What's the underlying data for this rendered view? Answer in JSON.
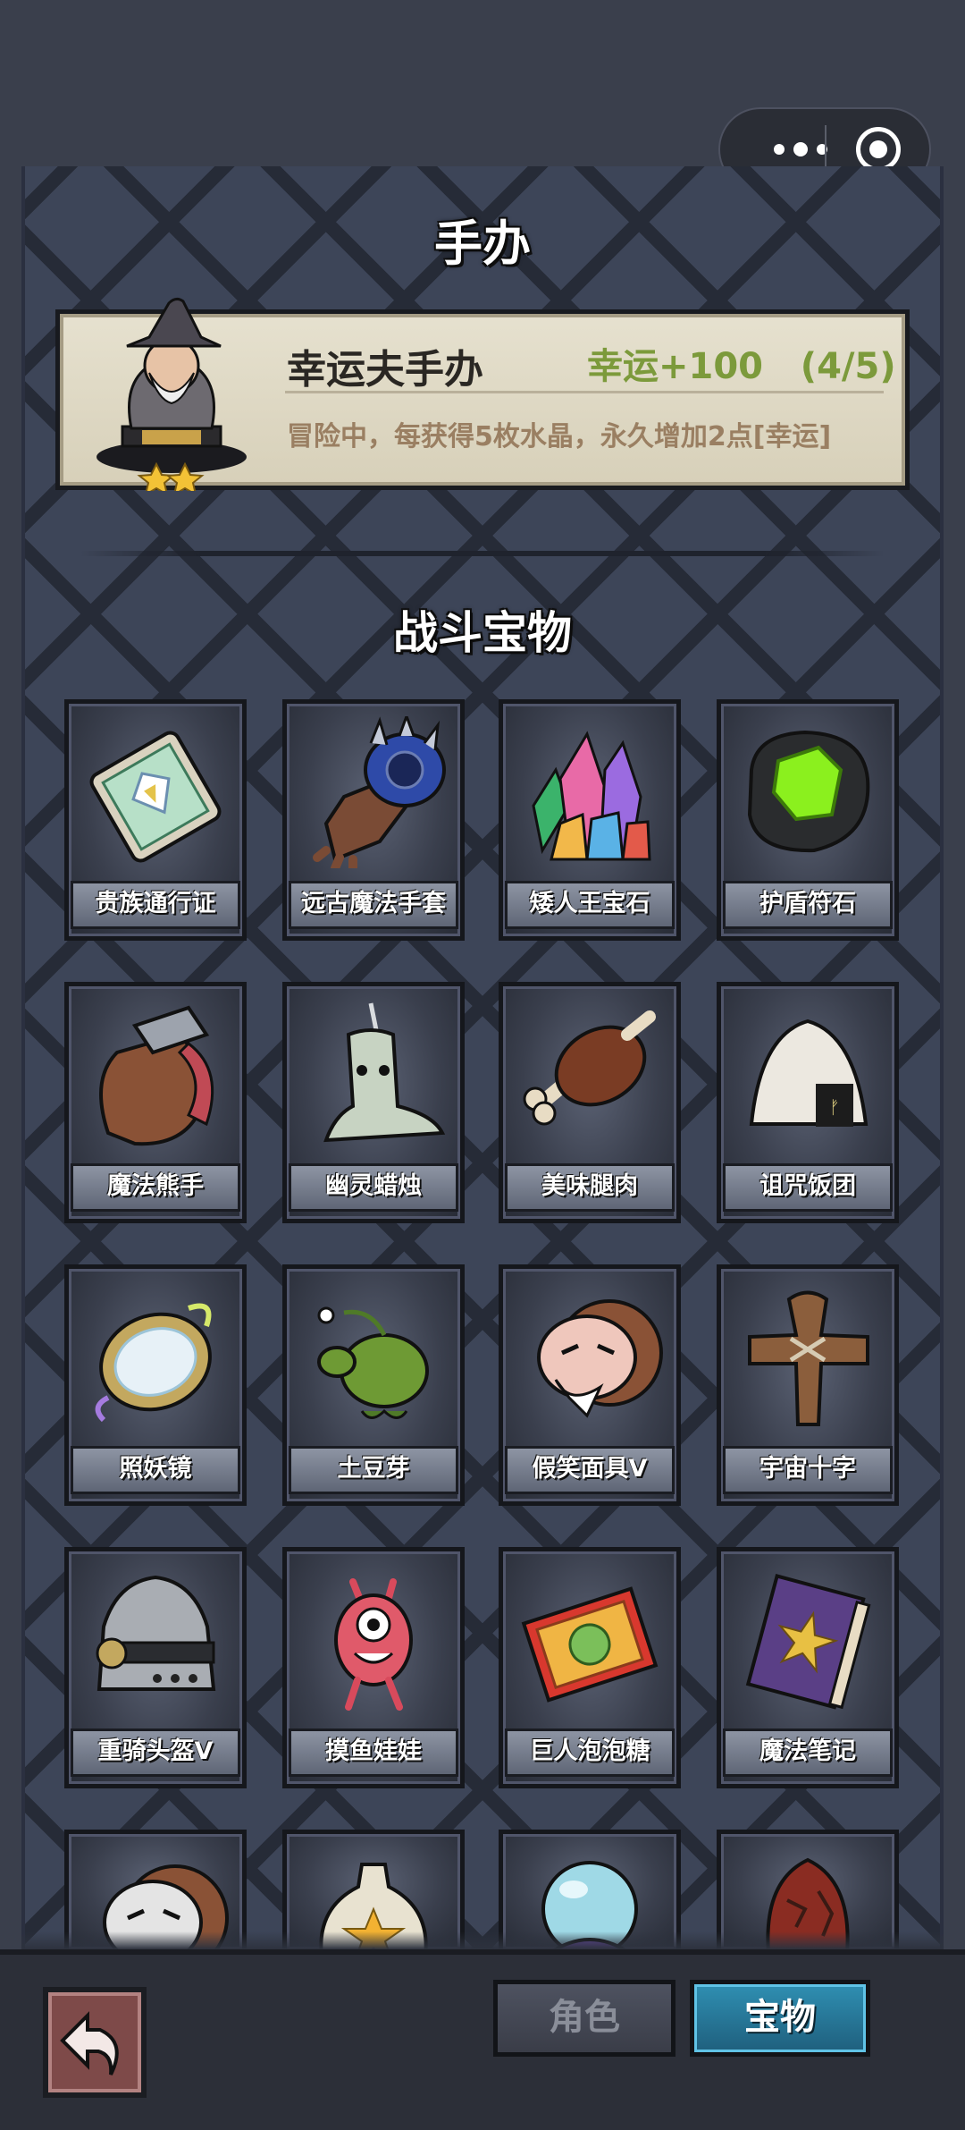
{
  "page_title": "手办",
  "figure": {
    "name": "幸运夫手办",
    "stat": "幸运+100",
    "progress": "(4/5)",
    "description": "冒险中，每获得5枚水晶，永久增加2点[幸运]",
    "stars": 2
  },
  "section_title": "战斗宝物",
  "treasures": [
    {
      "name": "贵族通行证",
      "icon": "pass-card-icon"
    },
    {
      "name": "远古魔法手套",
      "icon": "magic-glove-icon"
    },
    {
      "name": "矮人王宝石",
      "icon": "crystal-gem-icon"
    },
    {
      "name": "护盾符石",
      "icon": "shield-rune-icon"
    },
    {
      "name": "魔法熊手",
      "icon": "bear-paw-icon"
    },
    {
      "name": "幽灵蜡烛",
      "icon": "ghost-candle-icon"
    },
    {
      "name": "美味腿肉",
      "icon": "meat-leg-icon"
    },
    {
      "name": "诅咒饭团",
      "icon": "rice-ball-icon"
    },
    {
      "name": "照妖镜",
      "icon": "magic-mirror-icon"
    },
    {
      "name": "土豆芽",
      "icon": "potato-sprout-icon"
    },
    {
      "name": "假笑面具V",
      "icon": "smile-mask-icon"
    },
    {
      "name": "宇宙十字",
      "icon": "wooden-cross-icon"
    },
    {
      "name": "重骑头盔V",
      "icon": "knight-helmet-icon"
    },
    {
      "name": "摸鱼娃娃",
      "icon": "pink-doll-icon"
    },
    {
      "name": "巨人泡泡糖",
      "icon": "bubble-gum-icon"
    },
    {
      "name": "魔法笔记",
      "icon": "magic-book-icon"
    }
  ],
  "partial_row_icons": [
    "mask-icon",
    "star-bag-icon",
    "crystal-ball-icon",
    "lava-egg-icon"
  ],
  "tabs": {
    "role": "角色",
    "treasure": "宝物"
  },
  "active_tab": "宝物",
  "colors": {
    "accent_green": "#7c9a3b",
    "active_tab": "#2f8fb2",
    "panel": "#3d4558"
  }
}
